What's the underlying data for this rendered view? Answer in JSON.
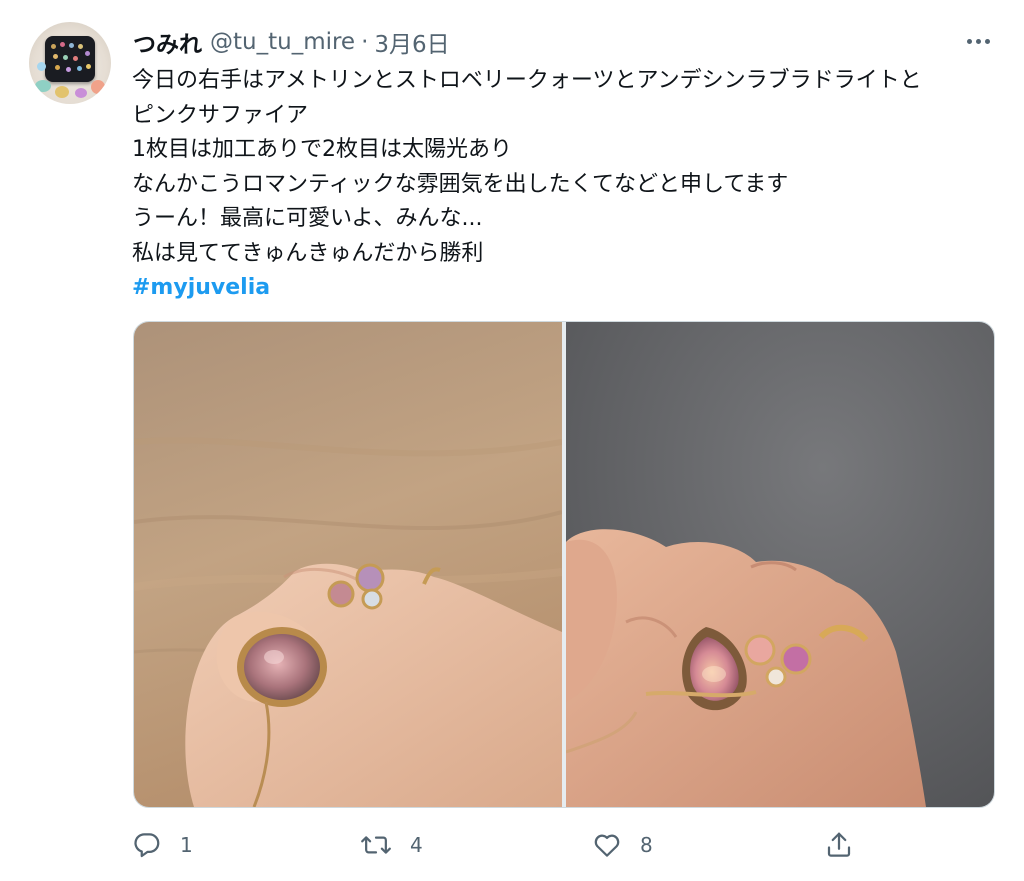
{
  "author": {
    "display_name": "つみれ",
    "handle": "@tu_tu_mire",
    "separator": "·",
    "date": "3月6日"
  },
  "tweet": {
    "lines": [
      "今日の右手はアメトリンとストロベリークォーツとアンデシンラブラドライトと",
      "ピンクサファイア",
      "1枚目は加工ありで2枚目は太陽光あり",
      "なんかこうロマンティックな雰囲気を出したくてなどと申してます",
      "うーん！最高に可愛いよ、みんな...",
      "私は見ててきゅんきゅんだから勝利"
    ],
    "hashtag": "#myjuvelia"
  },
  "actions": {
    "replies": "1",
    "retweets": "4",
    "likes": "8"
  },
  "icons": {
    "more": "more-icon",
    "reply": "reply-icon",
    "retweet": "retweet-icon",
    "like": "heart-icon",
    "share": "share-icon"
  },
  "colors": {
    "text": "#0f1419",
    "secondary": "#536471",
    "hashtag": "#1d9bf0",
    "border": "#cfd9de"
  }
}
